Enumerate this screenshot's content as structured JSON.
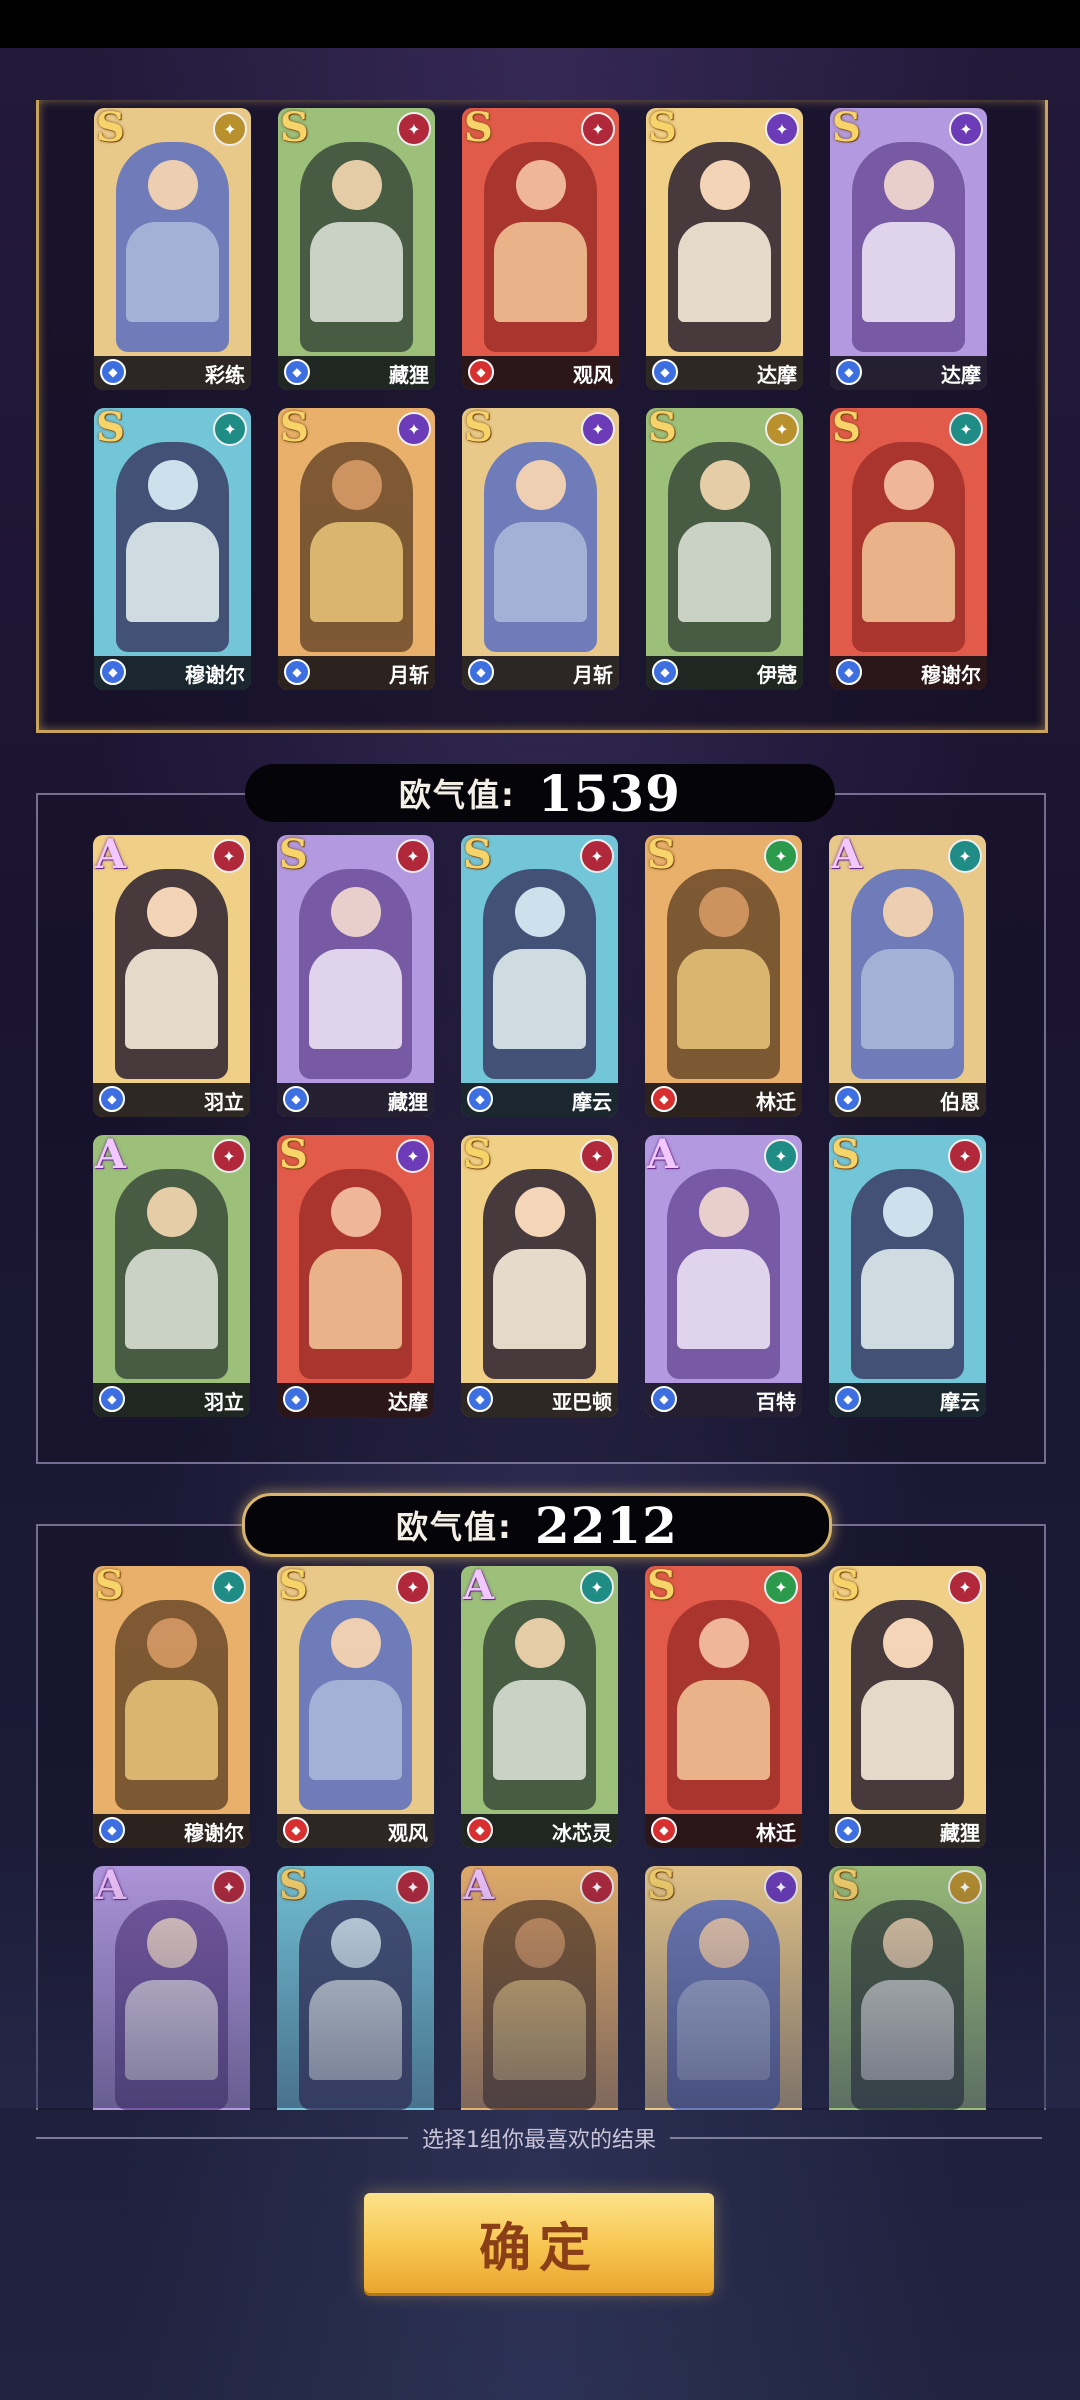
{
  "groups": [
    {
      "luck_label": "",
      "luck_value": "",
      "heroes": [
        {
          "name": "彩练",
          "rank": "S",
          "faction": "gold",
          "role": "blue"
        },
        {
          "name": "藏狸",
          "rank": "S",
          "faction": "red",
          "role": "blue"
        },
        {
          "name": "观风",
          "rank": "S",
          "faction": "red",
          "role": "red"
        },
        {
          "name": "达摩",
          "rank": "S",
          "faction": "purple",
          "role": "blue"
        },
        {
          "name": "达摩",
          "rank": "S",
          "faction": "purple",
          "role": "blue"
        },
        {
          "name": "穆谢尔",
          "rank": "S",
          "faction": "teal",
          "role": "blue"
        },
        {
          "name": "月斩",
          "rank": "S",
          "faction": "purple",
          "role": "blue"
        },
        {
          "name": "月斩",
          "rank": "S",
          "faction": "purple",
          "role": "blue"
        },
        {
          "name": "伊蒄",
          "rank": "S",
          "faction": "gold",
          "role": "blue"
        },
        {
          "name": "穆谢尔",
          "rank": "S",
          "faction": "teal",
          "role": "blue"
        }
      ]
    },
    {
      "luck_label": "欧气值:",
      "luck_value": "1539",
      "heroes": [
        {
          "name": "羽立",
          "rank": "A",
          "faction": "red",
          "role": "blue"
        },
        {
          "name": "藏狸",
          "rank": "S",
          "faction": "red",
          "role": "blue"
        },
        {
          "name": "摩云",
          "rank": "S",
          "faction": "red",
          "role": "blue"
        },
        {
          "name": "林迁",
          "rank": "S",
          "faction": "green",
          "role": "red"
        },
        {
          "name": "伯恩",
          "rank": "A",
          "faction": "teal",
          "role": "blue"
        },
        {
          "name": "羽立",
          "rank": "A",
          "faction": "red",
          "role": "blue"
        },
        {
          "name": "达摩",
          "rank": "S",
          "faction": "purple",
          "role": "blue"
        },
        {
          "name": "亚巴顿",
          "rank": "S",
          "faction": "red",
          "role": "blue"
        },
        {
          "name": "百特",
          "rank": "A",
          "faction": "teal",
          "role": "blue"
        },
        {
          "name": "摩云",
          "rank": "S",
          "faction": "red",
          "role": "blue"
        }
      ]
    },
    {
      "luck_label": "欧气值:",
      "luck_value": "2212",
      "heroes": [
        {
          "name": "穆谢尔",
          "rank": "S",
          "faction": "teal",
          "role": "blue"
        },
        {
          "name": "观风",
          "rank": "S",
          "faction": "red",
          "role": "red"
        },
        {
          "name": "冰芯灵",
          "rank": "A",
          "faction": "teal",
          "role": "red"
        },
        {
          "name": "林迁",
          "rank": "S",
          "faction": "green",
          "role": "red"
        },
        {
          "name": "藏狸",
          "rank": "S",
          "faction": "red",
          "role": "blue"
        },
        {
          "name": "",
          "rank": "A",
          "faction": "red",
          "role": "blue"
        },
        {
          "name": "",
          "rank": "S",
          "faction": "red",
          "role": "blue"
        },
        {
          "name": "",
          "rank": "A",
          "faction": "red",
          "role": "blue"
        },
        {
          "name": "",
          "rank": "S",
          "faction": "purple",
          "role": "blue"
        },
        {
          "name": "",
          "rank": "S",
          "faction": "gold",
          "role": "blue"
        }
      ]
    }
  ],
  "hint": "选择1组你最喜欢的结果",
  "confirm_label": "确定",
  "colors": {
    "gold_border": "#c9a35a",
    "button_top": "#fde28a",
    "button_bottom": "#eaa52f",
    "button_text": "#8a3f17"
  }
}
